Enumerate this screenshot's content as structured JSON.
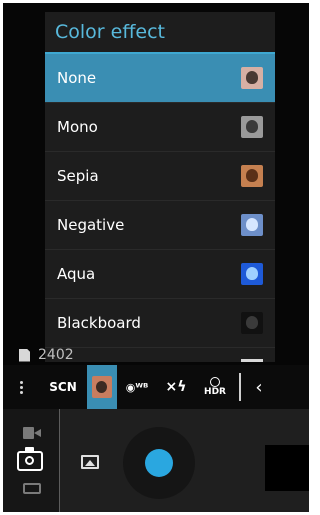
{
  "popup": {
    "title": "Color effect",
    "items": [
      {
        "label": "None",
        "selected": true,
        "thumb_bg": "#d7b0a4",
        "thumb_fg": "#4a3a33"
      },
      {
        "label": "Mono",
        "selected": false,
        "thumb_bg": "#9a9a9a",
        "thumb_fg": "#3a3a3a"
      },
      {
        "label": "Sepia",
        "selected": false,
        "thumb_bg": "#c58050",
        "thumb_fg": "#5a3018"
      },
      {
        "label": "Negative",
        "selected": false,
        "thumb_bg": "#6d8fc9",
        "thumb_fg": "#d6e6ff"
      },
      {
        "label": "Aqua",
        "selected": false,
        "thumb_bg": "#1e5ad8",
        "thumb_fg": "#9fd0ff"
      },
      {
        "label": "Blackboard",
        "selected": false,
        "thumb_bg": "#111111",
        "thumb_fg": "#3a3a3a"
      }
    ]
  },
  "storage": {
    "count": "2402"
  },
  "settings_bar": {
    "scene_label": "SCN",
    "white_balance_label": "◉ᵂᴮ",
    "flash_label": "×ϟ",
    "hdr_label": "HDR",
    "collapse_icon": "‹"
  },
  "colors": {
    "accent": "#3a8eb3",
    "title": "#58b9dc",
    "shutter": "#2aa7e0"
  }
}
